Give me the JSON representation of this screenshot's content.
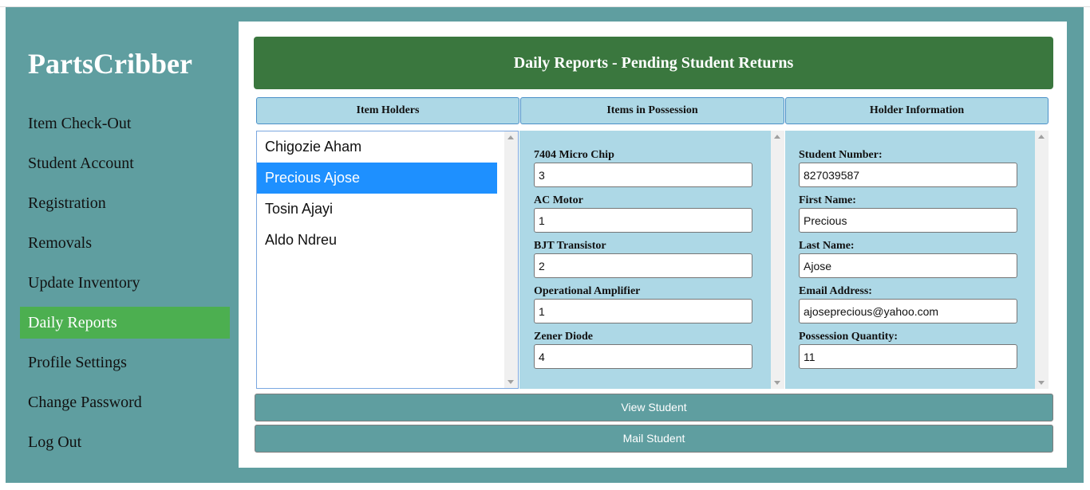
{
  "app": {
    "brand": "PartsCribber"
  },
  "nav": [
    {
      "label": "Item Check-Out"
    },
    {
      "label": "Student Account"
    },
    {
      "label": "Registration"
    },
    {
      "label": "Removals"
    },
    {
      "label": "Update Inventory"
    },
    {
      "label": "Daily Reports",
      "active": true
    },
    {
      "label": "Profile Settings"
    },
    {
      "label": "Change Password"
    },
    {
      "label": "Log Out"
    }
  ],
  "page": {
    "title": "Daily Reports - Pending Student Returns"
  },
  "columns": {
    "holders": "Item Holders",
    "items": "Items in Possession",
    "info": "Holder Information"
  },
  "holders": [
    {
      "name": "Chigozie Aham"
    },
    {
      "name": "Precious Ajose",
      "selected": true
    },
    {
      "name": "Tosin Ajayi"
    },
    {
      "name": "Aldo Ndreu"
    }
  ],
  "items": [
    {
      "label": "7404 Micro Chip",
      "value": "3"
    },
    {
      "label": "AC Motor",
      "value": "1"
    },
    {
      "label": "BJT Transistor",
      "value": "2"
    },
    {
      "label": "Operational Amplifier",
      "value": "1"
    },
    {
      "label": "Zener Diode",
      "value": "4"
    }
  ],
  "info": [
    {
      "label": "Student Number:",
      "value": "827039587"
    },
    {
      "label": "First Name:",
      "value": "Precious"
    },
    {
      "label": "Last Name:",
      "value": "Ajose"
    },
    {
      "label": "Email Address:",
      "value": "ajoseprecious@yahoo.com"
    },
    {
      "label": "Possession Quantity:",
      "value": "11"
    }
  ],
  "actions": {
    "view": "View Student",
    "mail": "Mail Student"
  },
  "colors": {
    "frame": "#5f9ea0",
    "header": "#3a773e",
    "nav_active": "#4caf50",
    "panel": "#add8e6",
    "selection": "#1e90ff"
  }
}
